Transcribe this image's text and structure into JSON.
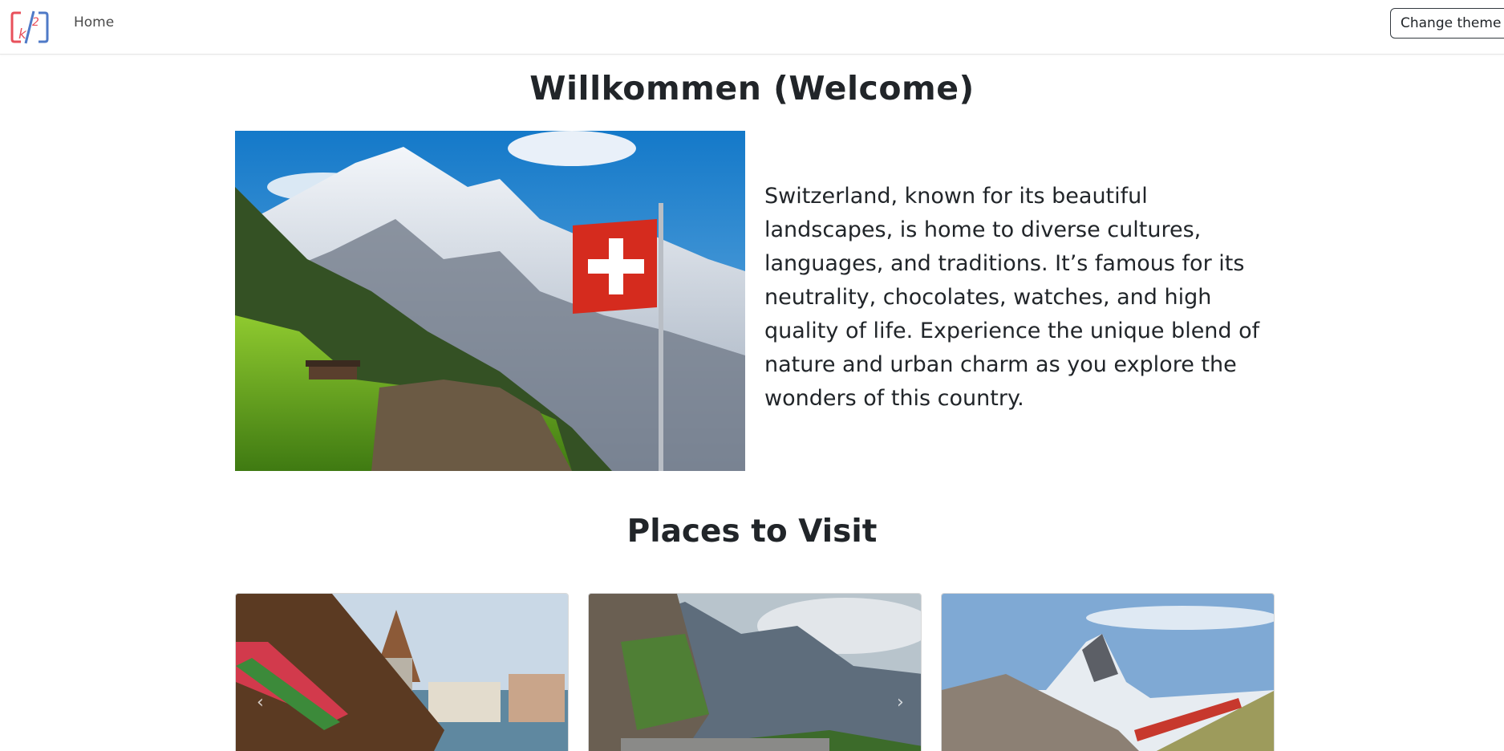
{
  "navbar": {
    "logo_text": "k2",
    "home_label": "Home",
    "theme_button_label": "Change theme"
  },
  "welcome": {
    "title": "Willkommen (Welcome)",
    "description": "Switzerland, known for its beautiful landscapes, is home to diverse cultures, languages, and traditions. It’s famous for its neutrality, chocolates, watches, and high quality of life. Experience the unique blend of nature and urban charm as you explore the wonders of this country."
  },
  "places": {
    "title": "Places to Visit",
    "carousel_prev_icon": "chevron-left-icon",
    "carousel_next_icon": "chevron-right-icon"
  },
  "colors": {
    "text": "#212529",
    "flag_red": "#d52b1e",
    "logo_red": "#e8505b",
    "logo_blue": "#4f7ac7"
  }
}
